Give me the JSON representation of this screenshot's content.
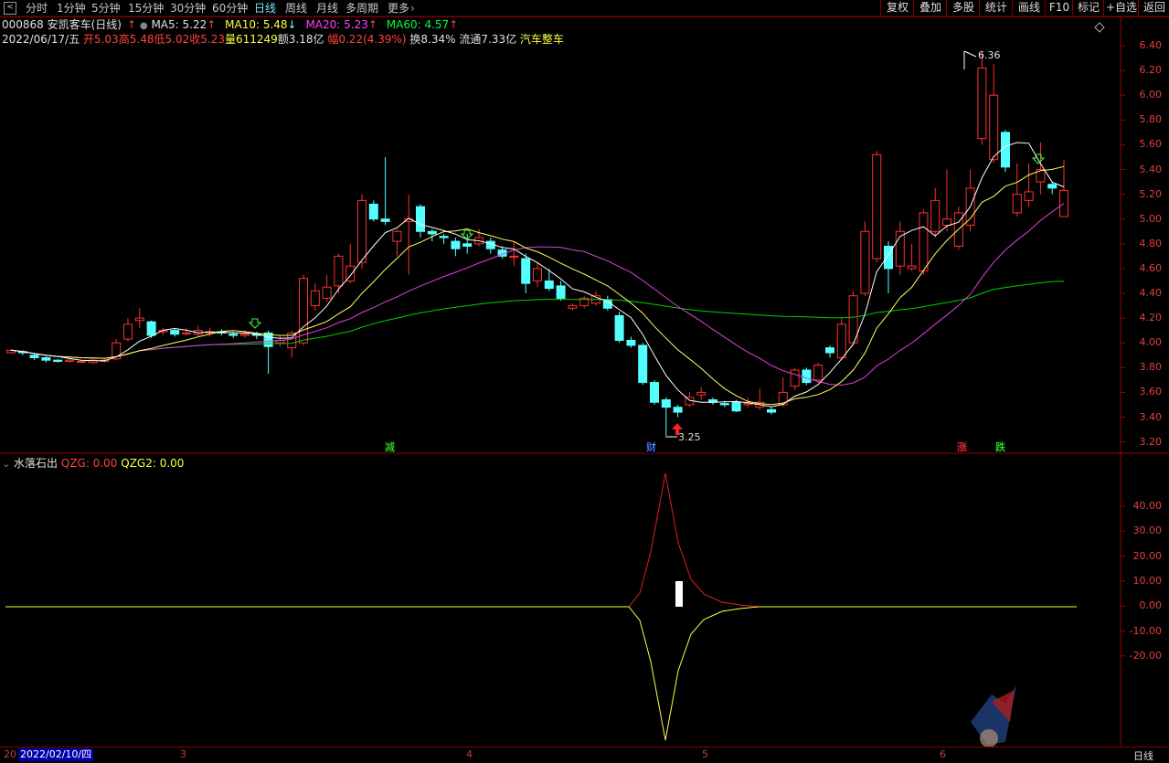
{
  "toolbar": {
    "tabs": [
      "分时",
      "1分钟",
      "5分钟",
      "15分钟",
      "30分钟",
      "60分钟",
      "日线",
      "周线",
      "月线",
      "多周期",
      "更多"
    ],
    "active_tab": "日线",
    "right_buttons": [
      "复权",
      "叠加",
      "多股",
      "统计",
      "画线",
      "F10",
      "标记",
      "+自选",
      "返回"
    ]
  },
  "info": {
    "code_name": "000868 安凯客车(日线)",
    "ma5": "MA5: 5.22",
    "ma10": "MA10: 5.48",
    "ma20": "MA20: 5.23",
    "ma60": "MA60: 4.57",
    "date": "2022/06/17/五",
    "open": "开5.03",
    "high": "高5.48",
    "low": "低5.02",
    "close": "收5.23",
    "volume": "量611249",
    "amount": "额3.18亿",
    "change": "幅0.22(4.39%)",
    "turnover": "换8.34%",
    "float_cap": "流通7.33亿",
    "sector": "汽车整车"
  },
  "price_axis": [
    "6.40",
    "6.20",
    "6.00",
    "5.80",
    "5.60",
    "5.40",
    "5.20",
    "5.00",
    "4.80",
    "4.60",
    "4.40",
    "4.20",
    "4.00",
    "3.80",
    "3.60",
    "3.40",
    "3.20"
  ],
  "price_annotations": {
    "high": "6.36",
    "low": "3.25"
  },
  "event_markers": [
    "减",
    "财",
    "涨",
    "跌"
  ],
  "indicator": {
    "name": "水落石出",
    "qzg": "QZG: 0.00",
    "qzg2": "QZG2: 0.00",
    "axis": [
      "40.00",
      "30.00",
      "20.00",
      "10.00",
      "0.00",
      "-10.00",
      "-20.00"
    ]
  },
  "bottom": {
    "left_stub": "20",
    "date_box": "2022/02/10/四",
    "x_labels": [
      "3",
      "4",
      "5",
      "6"
    ],
    "period": "日线"
  },
  "colors": {
    "up": "#ff3030",
    "down": "#54ffff",
    "ma5": "#ffffff",
    "ma10": "#ffff40",
    "ma20": "#ff40ff",
    "ma60": "#00d000"
  }
}
